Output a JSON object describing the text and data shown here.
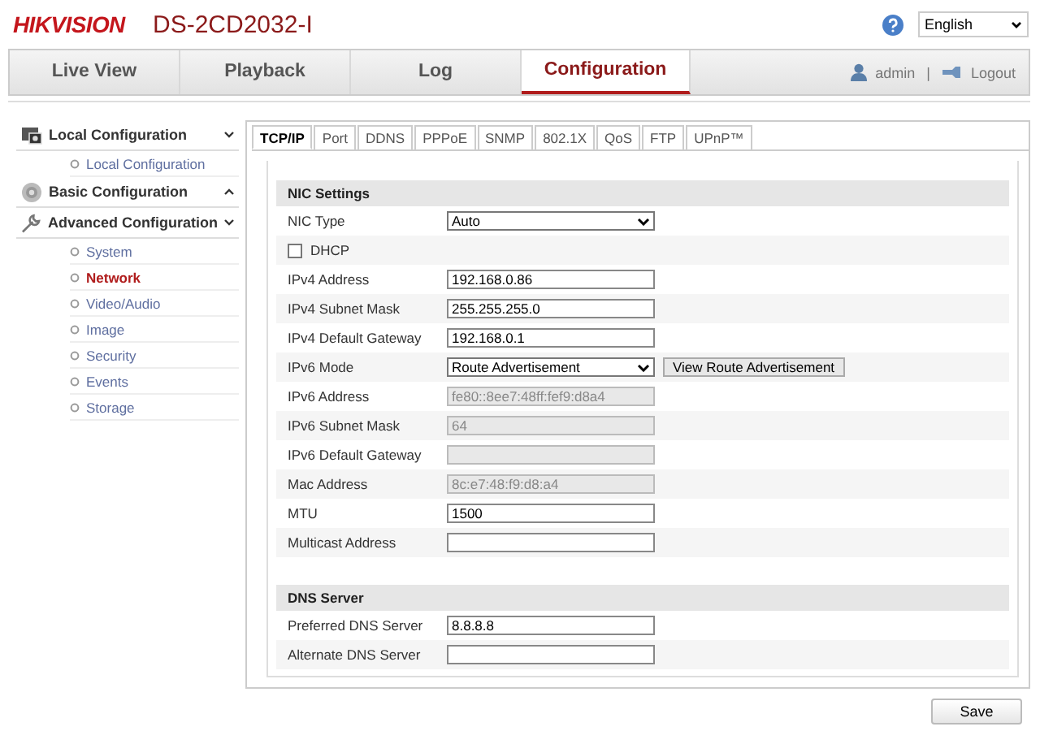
{
  "header": {
    "logo": "HIKVISION",
    "model": "DS-2CD2032-I",
    "language": "English"
  },
  "nav": {
    "tabs": [
      {
        "label": "Live View",
        "selected": false
      },
      {
        "label": "Playback",
        "selected": false
      },
      {
        "label": "Log",
        "selected": false
      },
      {
        "label": "Configuration",
        "selected": true
      }
    ],
    "user": "admin",
    "separator": "|",
    "logout": "Logout"
  },
  "sidebar": {
    "groups": [
      {
        "label": "Local Configuration",
        "kind": "local",
        "expanded": true,
        "children": [
          {
            "label": "Local Configuration",
            "selected": false
          }
        ]
      },
      {
        "label": "Basic Configuration",
        "kind": "basic",
        "expanded": false
      },
      {
        "label": "Advanced Configuration",
        "kind": "advanced",
        "expanded": true,
        "children": [
          {
            "label": "System",
            "selected": false
          },
          {
            "label": "Network",
            "selected": true
          },
          {
            "label": "Video/Audio",
            "selected": false
          },
          {
            "label": "Image",
            "selected": false
          },
          {
            "label": "Security",
            "selected": false
          },
          {
            "label": "Events",
            "selected": false
          },
          {
            "label": "Storage",
            "selected": false
          }
        ]
      }
    ]
  },
  "subtabs": [
    {
      "label": "TCP/IP",
      "selected": true
    },
    {
      "label": "Port",
      "selected": false
    },
    {
      "label": "DDNS",
      "selected": false
    },
    {
      "label": "PPPoE",
      "selected": false
    },
    {
      "label": "SNMP",
      "selected": false
    },
    {
      "label": "802.1X",
      "selected": false
    },
    {
      "label": "QoS",
      "selected": false
    },
    {
      "label": "FTP",
      "selected": false
    },
    {
      "label": "UPnP™",
      "selected": false
    }
  ],
  "sections": [
    {
      "title": "NIC Settings",
      "rows": [
        {
          "kind": "select",
          "label": "NIC Type",
          "value": "Auto"
        },
        {
          "kind": "checkbox",
          "label": "DHCP",
          "checked": false
        },
        {
          "kind": "input",
          "label": "IPv4 Address",
          "value": "192.168.0.86",
          "disabled": false
        },
        {
          "kind": "input",
          "label": "IPv4 Subnet Mask",
          "value": "255.255.255.0",
          "disabled": false
        },
        {
          "kind": "input",
          "label": "IPv4 Default Gateway",
          "value": "192.168.0.1",
          "disabled": false
        },
        {
          "kind": "select",
          "label": "IPv6 Mode",
          "value": "Route Advertisement",
          "button": "View Route Advertisement"
        },
        {
          "kind": "input",
          "label": "IPv6 Address",
          "value": "fe80::8ee7:48ff:fef9:d8a4",
          "disabled": true
        },
        {
          "kind": "input",
          "label": "IPv6 Subnet Mask",
          "value": "64",
          "disabled": true
        },
        {
          "kind": "input",
          "label": "IPv6 Default Gateway",
          "disabled": true
        },
        {
          "kind": "input",
          "label": "Mac Address",
          "value": "8c:e7:48:f9:d8:a4",
          "disabled": true
        },
        {
          "kind": "input",
          "label": "MTU",
          "value": "1500",
          "disabled": false
        },
        {
          "kind": "input",
          "label": "Multicast Address",
          "disabled": false
        }
      ]
    },
    {
      "title": "DNS Server",
      "rows": [
        {
          "kind": "input",
          "label": "Preferred DNS Server",
          "value": "8.8.8.8",
          "disabled": false
        },
        {
          "kind": "input",
          "label": "Alternate DNS Server",
          "disabled": false
        }
      ]
    }
  ],
  "save": "Save"
}
